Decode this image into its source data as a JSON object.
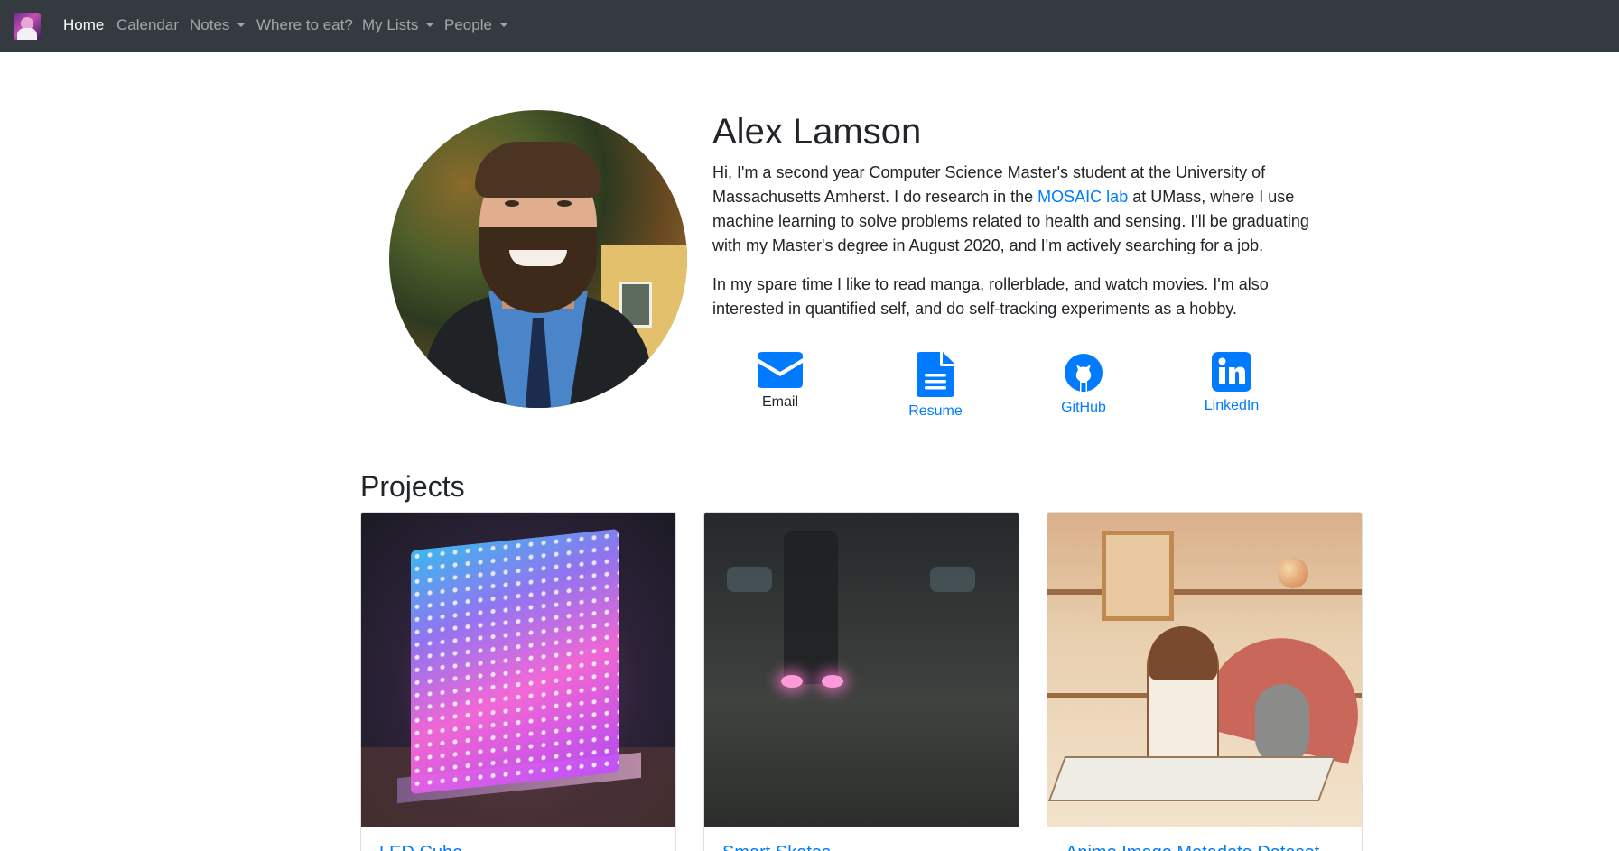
{
  "navbar": {
    "brand_icon": "site-avatar-icon",
    "items": [
      {
        "label": "Home",
        "active": true,
        "dropdown": false
      },
      {
        "label": "Calendar",
        "active": false,
        "dropdown": false
      },
      {
        "label": "Notes",
        "active": false,
        "dropdown": true
      },
      {
        "label": "Where to eat?",
        "active": false,
        "dropdown": false
      },
      {
        "label": "My Lists",
        "active": false,
        "dropdown": true
      },
      {
        "label": "People",
        "active": false,
        "dropdown": true
      }
    ]
  },
  "profile": {
    "name": "Alex Lamson",
    "bio1_before": "Hi, I'm a second year Computer Science Master's student at the University of Massachusetts Amherst. I do research in the ",
    "bio1_link": "MOSAIC lab",
    "bio1_after": " at UMass, where I use machine learning to solve problems related to health and sensing. I'll be graduating with my Master's degree in August 2020, and I'm actively searching for a job.",
    "bio2": "In my spare time I like to read manga, rollerblade, and watch movies. I'm also interested in quantified self, and do self-tracking experiments as a hobby."
  },
  "contacts": [
    {
      "label": "Email",
      "icon": "envelope-icon"
    },
    {
      "label": "Resume",
      "icon": "document-icon"
    },
    {
      "label": "GitHub",
      "icon": "github-icon"
    },
    {
      "label": "LinkedIn",
      "icon": "linkedin-icon"
    }
  ],
  "projects": {
    "title": "Projects",
    "cards": [
      {
        "title": "LED Cube"
      },
      {
        "title": "Smart Skates"
      },
      {
        "title": "Anime Image Metadata Dataset"
      }
    ]
  },
  "colors": {
    "navbar_bg": "#343a40",
    "link": "#007bff",
    "text": "#212529"
  }
}
